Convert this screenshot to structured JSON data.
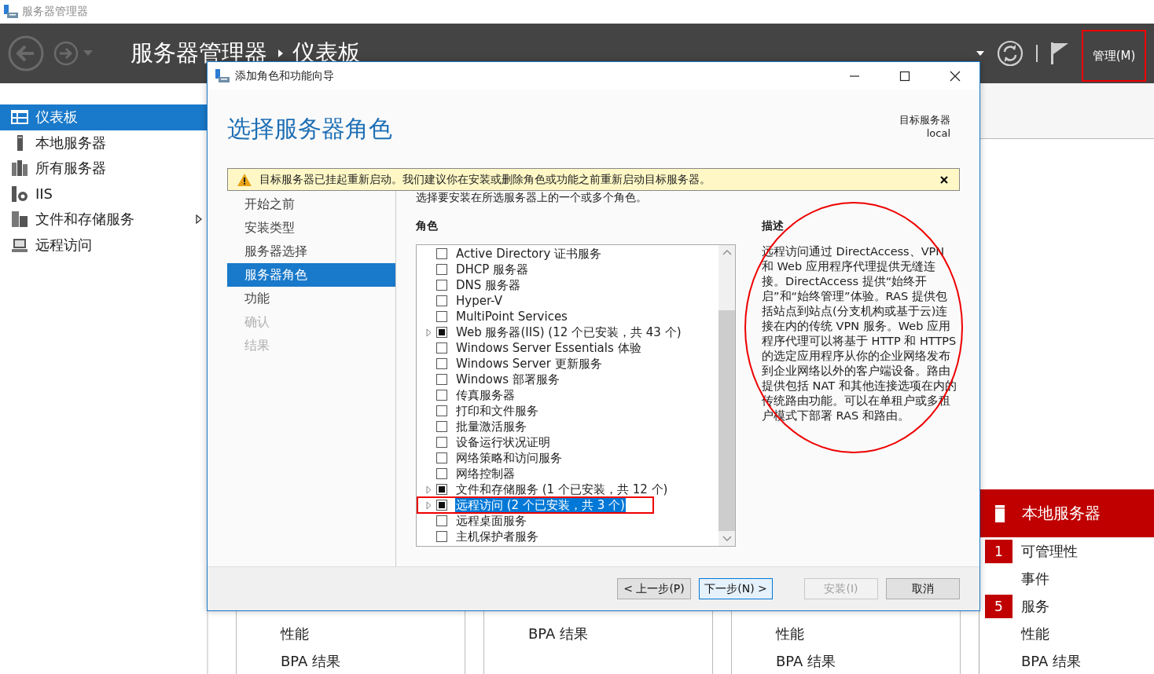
{
  "window": {
    "title": "服务器管理器"
  },
  "header": {
    "app": "服务器管理器",
    "page": "仪表板",
    "manage_menu": {
      "label": "管理(M)",
      "highlighted": true
    }
  },
  "sidebar": {
    "items": [
      {
        "label": "仪表板",
        "kind": "dashboard",
        "selected": true,
        "expandable": false
      },
      {
        "label": "本地服务器",
        "kind": "server",
        "selected": false,
        "expandable": false
      },
      {
        "label": "所有服务器",
        "kind": "servers",
        "selected": false,
        "expandable": false
      },
      {
        "label": "IIS",
        "kind": "iis",
        "selected": false,
        "expandable": false
      },
      {
        "label": "文件和存储服务",
        "kind": "storage",
        "selected": false,
        "expandable": true
      },
      {
        "label": "远程访问",
        "kind": "remote",
        "selected": false,
        "expandable": false
      }
    ]
  },
  "tiles": [
    {
      "items": [
        "性能",
        "BPA 结果"
      ]
    },
    {
      "items": [
        "BPA 结果"
      ]
    },
    {
      "items": [
        "性能",
        "BPA 结果"
      ]
    }
  ],
  "local_server_tile": {
    "title": "本地服务器",
    "items": [
      {
        "label": "可管理性",
        "count": "1"
      },
      {
        "label": "事件"
      },
      {
        "label": "服务",
        "count": "5"
      },
      {
        "label": "性能"
      },
      {
        "label": "BPA 结果"
      }
    ]
  },
  "dialog": {
    "title": "添加角色和功能向导",
    "heading": "选择服务器角色",
    "target_label": "目标服务器",
    "target_value": "local",
    "warning": "目标服务器已挂起重新启动。我们建议你在安装或删除角色或功能之前重新启动目标服务器。",
    "steps": [
      {
        "label": "开始之前",
        "selected": false,
        "disabled": false
      },
      {
        "label": "安装类型",
        "selected": false,
        "disabled": false
      },
      {
        "label": "服务器选择",
        "selected": false,
        "disabled": false
      },
      {
        "label": "服务器角色",
        "selected": true,
        "disabled": false
      },
      {
        "label": "功能",
        "selected": false,
        "disabled": false
      },
      {
        "label": "确认",
        "selected": false,
        "disabled": true
      },
      {
        "label": "结果",
        "selected": false,
        "disabled": true
      }
    ],
    "intro": "选择要安装在所选服务器上的一个或多个角色。",
    "roles_heading": "角色",
    "roles": [
      {
        "label": "Active Directory 证书服务",
        "checked": false,
        "expandable": false,
        "selected": false,
        "highlighted": false
      },
      {
        "label": "DHCP 服务器",
        "checked": false,
        "expandable": false,
        "selected": false,
        "highlighted": false
      },
      {
        "label": "DNS 服务器",
        "checked": false,
        "expandable": false,
        "selected": false,
        "highlighted": false
      },
      {
        "label": "Hyper-V",
        "checked": false,
        "expandable": false,
        "selected": false,
        "highlighted": false
      },
      {
        "label": "MultiPoint Services",
        "checked": false,
        "expandable": false,
        "selected": false,
        "highlighted": false
      },
      {
        "label": "Web 服务器(IIS) (12 个已安装，共 43 个)",
        "checked": true,
        "expandable": true,
        "selected": false,
        "highlighted": false
      },
      {
        "label": "Windows Server Essentials 体验",
        "checked": false,
        "expandable": false,
        "selected": false,
        "highlighted": false
      },
      {
        "label": "Windows Server 更新服务",
        "checked": false,
        "expandable": false,
        "selected": false,
        "highlighted": false
      },
      {
        "label": "Windows 部署服务",
        "checked": false,
        "expandable": false,
        "selected": false,
        "highlighted": false
      },
      {
        "label": "传真服务器",
        "checked": false,
        "expandable": false,
        "selected": false,
        "highlighted": false
      },
      {
        "label": "打印和文件服务",
        "checked": false,
        "expandable": false,
        "selected": false,
        "highlighted": false
      },
      {
        "label": "批量激活服务",
        "checked": false,
        "expandable": false,
        "selected": false,
        "highlighted": false
      },
      {
        "label": "设备运行状况证明",
        "checked": false,
        "expandable": false,
        "selected": false,
        "highlighted": false
      },
      {
        "label": "网络策略和访问服务",
        "checked": false,
        "expandable": false,
        "selected": false,
        "highlighted": false
      },
      {
        "label": "网络控制器",
        "checked": false,
        "expandable": false,
        "selected": false,
        "highlighted": false
      },
      {
        "label": "文件和存储服务 (1 个已安装，共 12 个)",
        "checked": true,
        "expandable": true,
        "selected": false,
        "highlighted": false
      },
      {
        "label": "远程访问 (2 个已安装，共 3 个)",
        "checked": true,
        "expandable": true,
        "selected": true,
        "highlighted": true
      },
      {
        "label": "远程桌面服务",
        "checked": false,
        "expandable": false,
        "selected": false,
        "highlighted": false
      },
      {
        "label": "主机保护者服务",
        "checked": false,
        "expandable": false,
        "selected": false,
        "highlighted": false
      }
    ],
    "description_heading": "描述",
    "description": "远程访问通过 DirectAccess、VPN 和 Web 应用程序代理提供无缝连接。DirectAccess 提供“始终开启”和“始终管理”体验。RAS 提供包括站点到站点(分支机构或基于云)连接在内的传统 VPN 服务。Web 应用程序代理可以将基于 HTTP 和 HTTPS 的选定应用程序从你的企业网络发布到企业网络以外的客户端设备。路由提供包括 NAT 和其他连接选项在内的传统路由功能。可以在单租户或多租户模式下部署 RAS 和路由。",
    "description_circled": true,
    "buttons": [
      {
        "label": "< 上一步(P)",
        "kind": "prev",
        "disabled": false
      },
      {
        "label": "下一步(N) >",
        "kind": "next",
        "disabled": false
      },
      {
        "label": "安装(I)",
        "kind": "install",
        "disabled": true
      },
      {
        "label": "取消",
        "kind": "cancel",
        "disabled": false
      }
    ]
  }
}
